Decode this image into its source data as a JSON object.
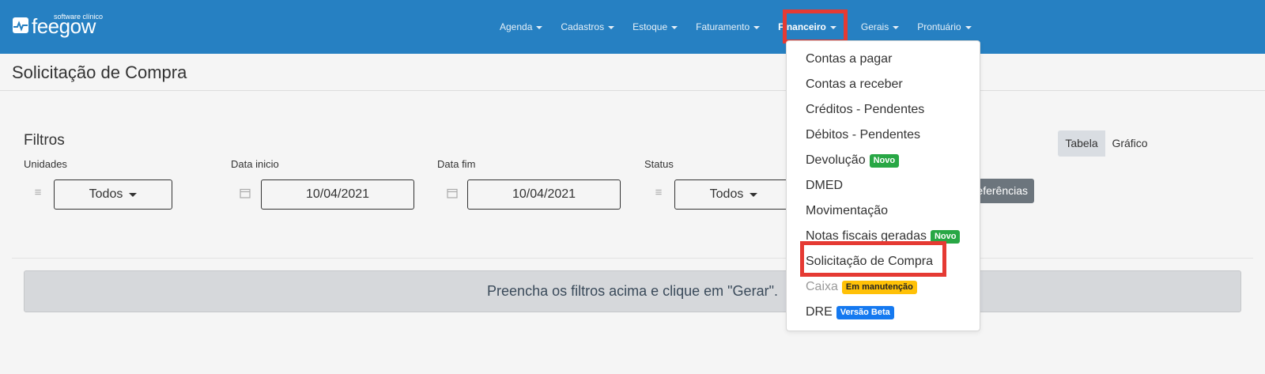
{
  "logo": {
    "brand": "feegow",
    "sub": "software clínico"
  },
  "nav": [
    {
      "label": "Agenda",
      "active": false
    },
    {
      "label": "Cadastros",
      "active": false
    },
    {
      "label": "Estoque",
      "active": false
    },
    {
      "label": "Faturamento",
      "active": false
    },
    {
      "label": "Financeiro",
      "active": true
    },
    {
      "label": "Gerais",
      "active": false
    },
    {
      "label": "Prontuário",
      "active": false
    }
  ],
  "page": {
    "title": "Solicitação de Compra"
  },
  "filters": {
    "title": "Filtros",
    "unidades": {
      "label": "Unidades",
      "value": "Todos",
      "icon": "list-icon"
    },
    "data_inicio": {
      "label": "Data inicio",
      "value": "10/04/2021",
      "icon": "calendar-icon"
    },
    "data_fim": {
      "label": "Data fim",
      "value": "10/04/2021",
      "icon": "calendar-icon"
    },
    "status": {
      "label": "Status",
      "value": "Todos",
      "icon": "list-icon"
    }
  },
  "preferences_button": "eferências",
  "view_toggle": {
    "table": "Tabela",
    "chart": "Gráfico"
  },
  "notice": "Preencha os filtros acima e clique em \"Gerar\".",
  "dropdown": {
    "items": [
      {
        "label": "Contas a pagar",
        "badge": ""
      },
      {
        "label": "Contas a receber",
        "badge": ""
      },
      {
        "label": "Créditos - Pendentes",
        "badge": ""
      },
      {
        "label": "Débitos - Pendentes",
        "badge": ""
      },
      {
        "label": "Devolução",
        "badge": "Novo"
      },
      {
        "label": "DMED",
        "badge": ""
      },
      {
        "label": "Movimentação",
        "badge": ""
      },
      {
        "label": "Notas fiscais geradas",
        "badge": "Novo"
      },
      {
        "label": "Solicitação de Compra",
        "badge": ""
      },
      {
        "label": "Caixa",
        "badge": "Em manutenção"
      },
      {
        "label": "DRE",
        "badge": "Versão Beta"
      }
    ]
  },
  "colors": {
    "header": "#2680c2",
    "highlight": "#e53a33",
    "badge_green": "#28a745",
    "badge_yellow": "#ffc107",
    "badge_blue": "#1579f0"
  }
}
